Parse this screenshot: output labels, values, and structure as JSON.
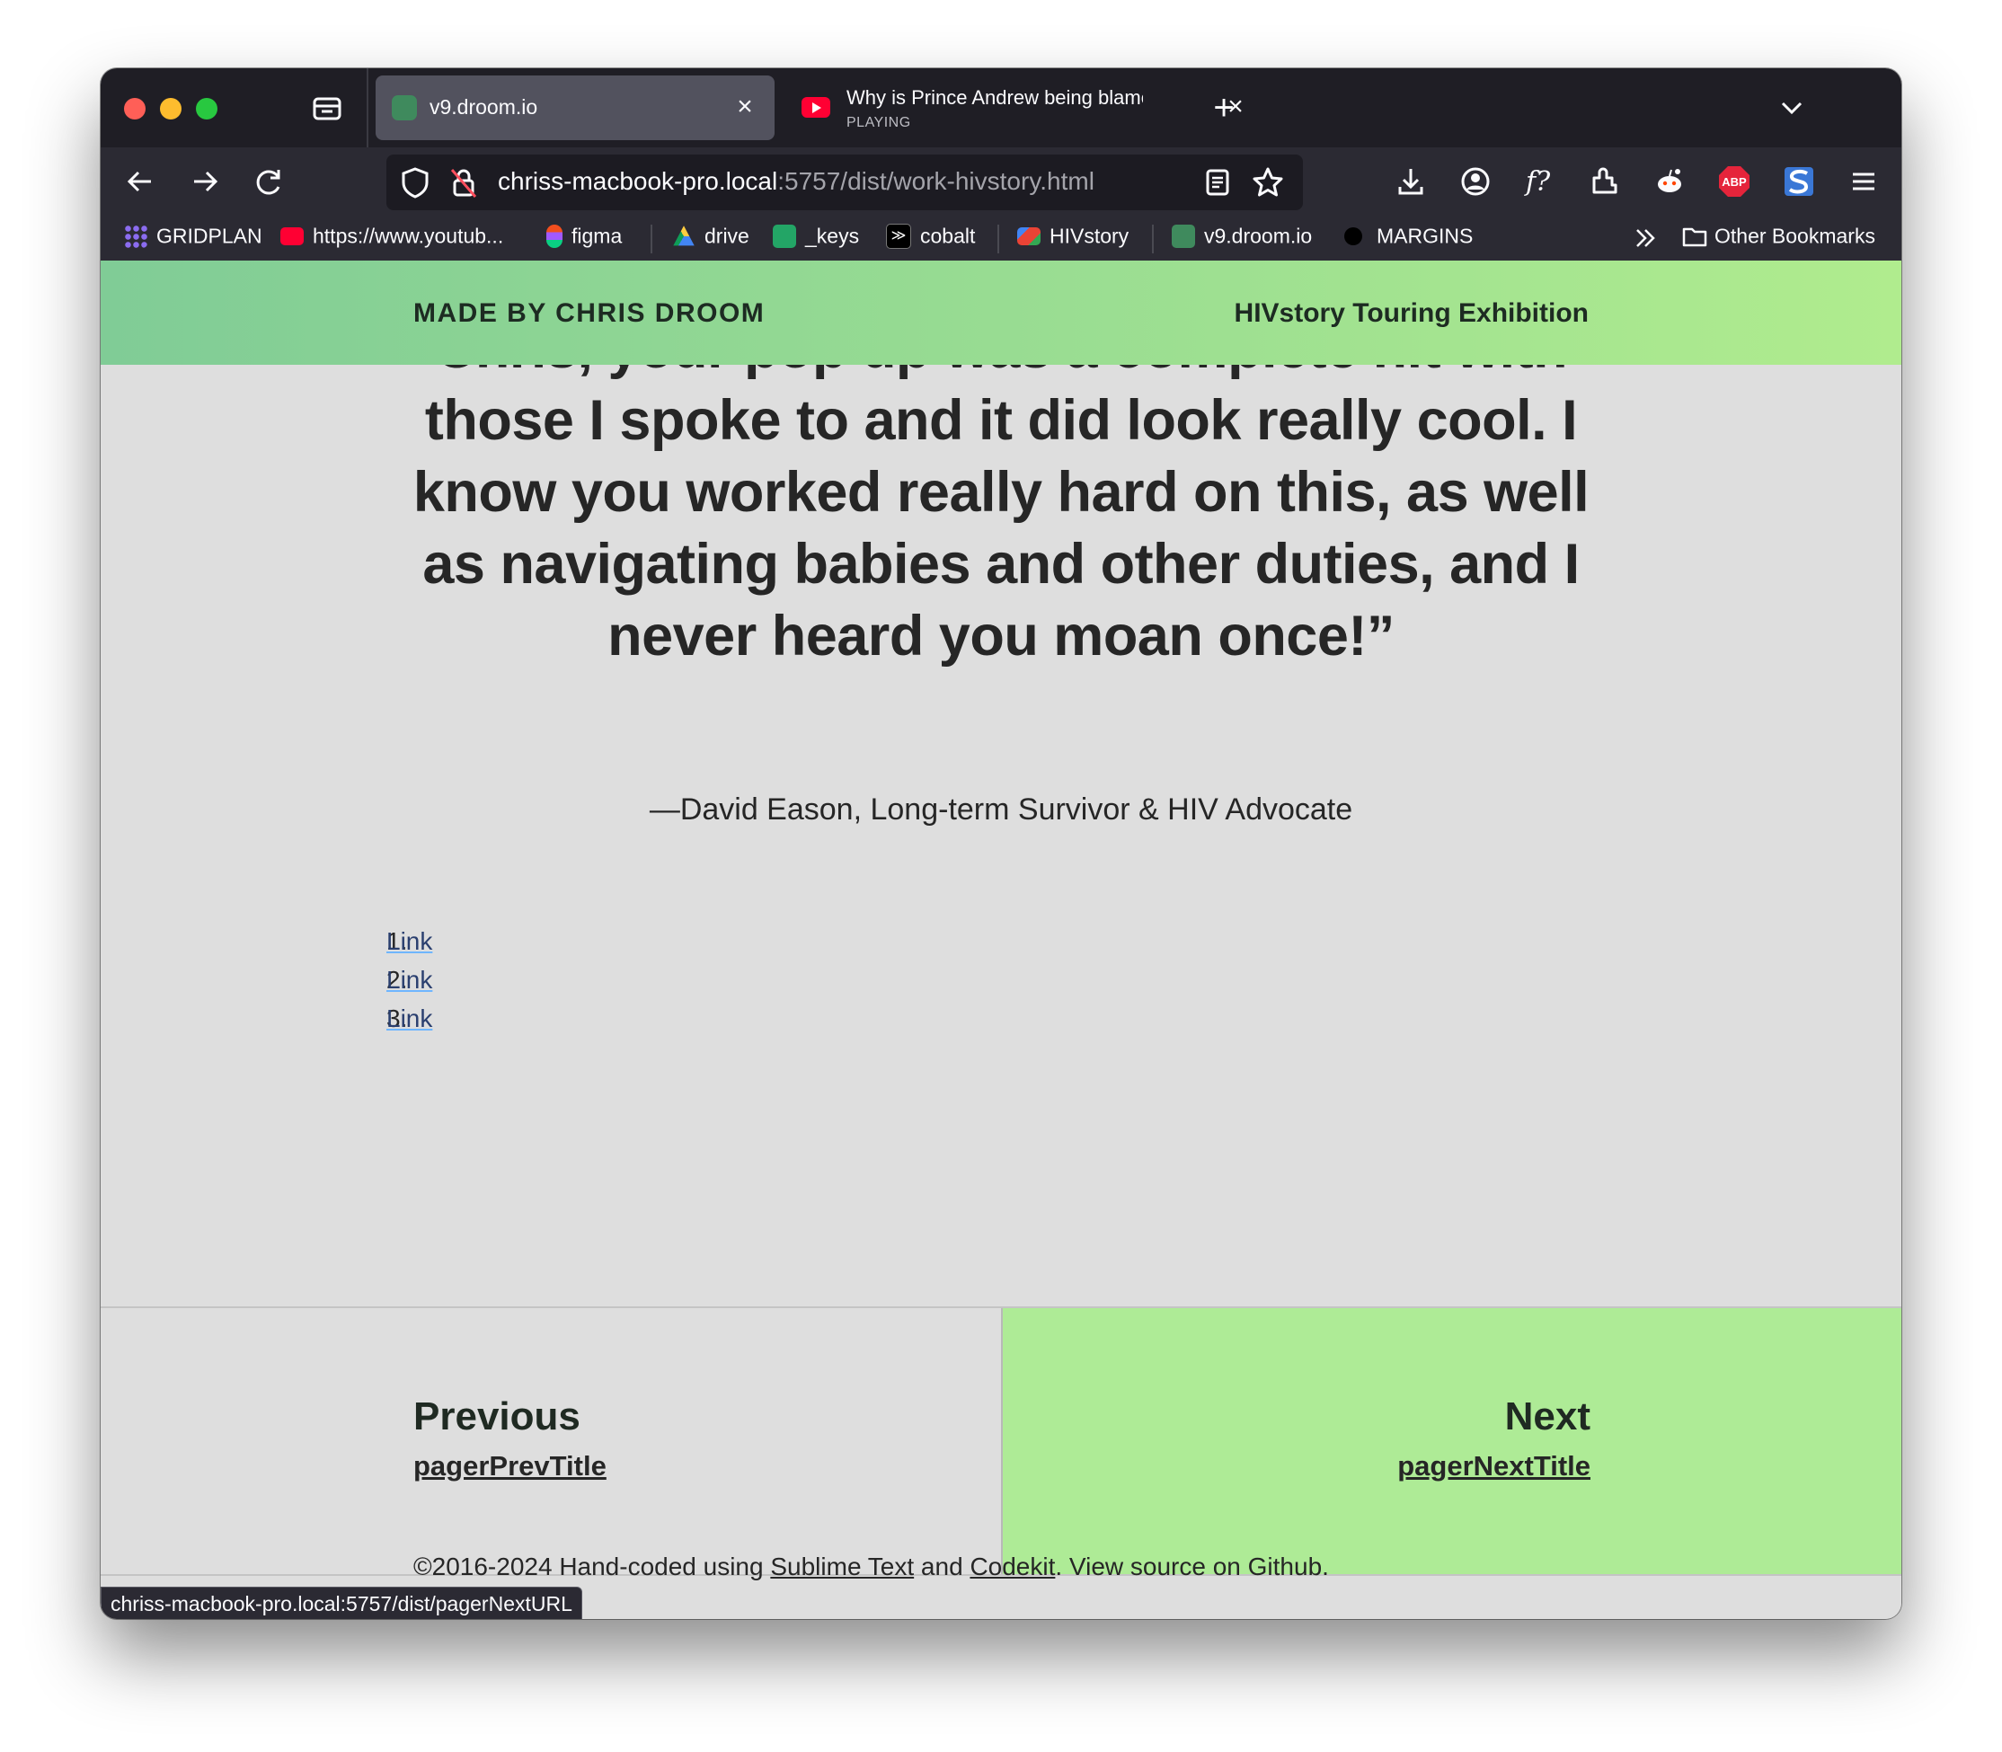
{
  "browser": {
    "tabs": [
      {
        "title": "v9.droom.io",
        "active": true
      },
      {
        "title": "Why is Prince Andrew being blamed",
        "subtitle": "PLAYING",
        "active": false
      }
    ],
    "url": {
      "host": "chriss-macbook-pro.local",
      "path": ":5757/dist/work-hivstory.html"
    },
    "bookmarks": [
      {
        "label": "GRIDPLAN",
        "icon": "grid-icon"
      },
      {
        "label": "https://www.youtub...",
        "icon": "youtube-icon"
      },
      {
        "label": "figma",
        "icon": "figma-icon"
      },
      {
        "label": "drive",
        "icon": "drive-icon"
      },
      {
        "label": "_keys",
        "icon": "sheets-icon"
      },
      {
        "label": "cobalt",
        "icon": "cobalt-icon"
      },
      {
        "label": "HIVstory",
        "icon": "gmail-icon"
      },
      {
        "label": "v9.droom.io",
        "icon": "site-icon"
      },
      {
        "label": "MARGINS",
        "icon": "dot-icon"
      }
    ],
    "other_bookmarks": "Other Bookmarks",
    "status_url": "chriss-macbook-pro.local:5757/dist/pagerNextURL",
    "abp_label": "ABP"
  },
  "site": {
    "brand": "MADE BY CHRIS DROOM",
    "title": "HIVstory Touring Exhibition",
    "quote_lines": [
      "Chris, your pop up was a complete hit with",
      "those I spoke to and it did look really cool. I",
      "know you worked really hard on this, as well",
      "as navigating babies and other duties, and I",
      "never heard you moan once!”"
    ],
    "attribution": "—David Eason, Long-term Survivor & HIV Advocate",
    "links": [
      {
        "num": "1.",
        "label": "Link"
      },
      {
        "num": "2.",
        "label": "Link"
      },
      {
        "num": "3.",
        "label": "Link"
      }
    ],
    "pager": {
      "prev_heading": "Previous",
      "prev_title": "pagerPrevTitle",
      "next_heading": "Next",
      "next_title": "pagerNextTitle"
    },
    "footer": {
      "prefix": "©2016-2024 Hand-coded using ",
      "link1": "Sublime Text",
      "mid": " and ",
      "link2": "Codekit",
      "suffix": ". View source on Github."
    }
  },
  "colors": {
    "header_start": "#80cc96",
    "header_end": "#b0ec8e",
    "next_bg": "#aeeb96",
    "page_bg": "#dedede"
  }
}
